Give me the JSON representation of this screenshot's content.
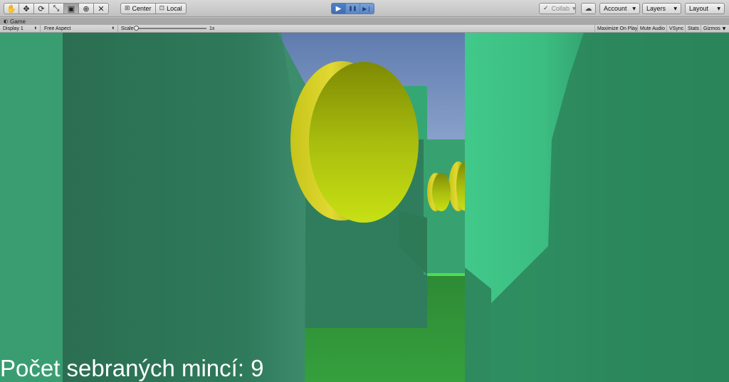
{
  "toolbar": {
    "tools": [
      {
        "name": "hand-tool",
        "glyph": "✋"
      },
      {
        "name": "move-tool",
        "glyph": "✥"
      },
      {
        "name": "rotate-tool",
        "glyph": "⟳"
      },
      {
        "name": "scale-tool",
        "glyph": "⤡"
      },
      {
        "name": "rect-tool",
        "glyph": "▣"
      },
      {
        "name": "transform-tool",
        "glyph": "⊕"
      },
      {
        "name": "custom-tool",
        "glyph": "✕"
      }
    ],
    "pivot_label": "Center",
    "space_label": "Local",
    "play_glyph": "▶",
    "pause_glyph": "❚❚",
    "step_glyph": "▶❘",
    "collab_label": "Collab",
    "cloud_glyph": "☁",
    "account_label": "Account",
    "layers_label": "Layers",
    "layout_label": "Layout",
    "caret_glyph": "▼"
  },
  "tab": {
    "title": "Game"
  },
  "game_bar": {
    "display": "Display 1",
    "aspect": "Free Aspect",
    "scale_label": "Scale",
    "scale_value": "1x",
    "maximize": "Maximize On Play",
    "mute": "Mute Audio",
    "vsync": "VSync",
    "stats": "Stats",
    "gizmos": "Gizmos"
  },
  "hud": {
    "coin_counter": "Počet sebraných mincí: 9"
  },
  "colors": {
    "wall_dark": "#2d7458",
    "wall_light": "#40c687",
    "sky": "#6f89b7",
    "floor": "#339438",
    "coin": "#c4dc12",
    "coin_edge": "#8c9a05"
  }
}
